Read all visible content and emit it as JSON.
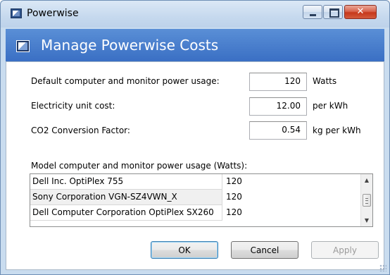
{
  "window": {
    "title": "Powerwise"
  },
  "header": {
    "title": "Manage Powerwise Costs"
  },
  "settings": {
    "default_power": {
      "label": "Default computer and monitor power usage:",
      "value": "120",
      "unit": "Watts"
    },
    "electricity_cost": {
      "label": "Electricity unit cost:",
      "value": "12.00",
      "unit": "per kWh"
    },
    "co2_factor": {
      "label": "CO2 Conversion Factor:",
      "value": "0.54",
      "unit": "kg per kWh"
    }
  },
  "models": {
    "label": "Model computer and monitor power usage (Watts):",
    "rows": [
      {
        "name": "Dell Inc. OptiPlex 755",
        "watts": "120"
      },
      {
        "name": "Sony Corporation VGN-SZ4VWN_X",
        "watts": "120"
      },
      {
        "name": "Dell Computer Corporation OptiPlex SX260",
        "watts": "120"
      }
    ]
  },
  "buttons": {
    "ok": "OK",
    "cancel": "Cancel",
    "apply": "Apply"
  },
  "icons": {
    "app": "powerwise-app-icon",
    "minimize": "minimize-icon",
    "maximize": "maximize-icon",
    "close": "close-icon",
    "scroll_up": "scroll-up-arrow-icon",
    "scroll_down": "scroll-down-arrow-icon"
  },
  "colors": {
    "header_band": "#3a6fc4",
    "close_button": "#c7381c",
    "window_frame": "#c9dcef"
  }
}
